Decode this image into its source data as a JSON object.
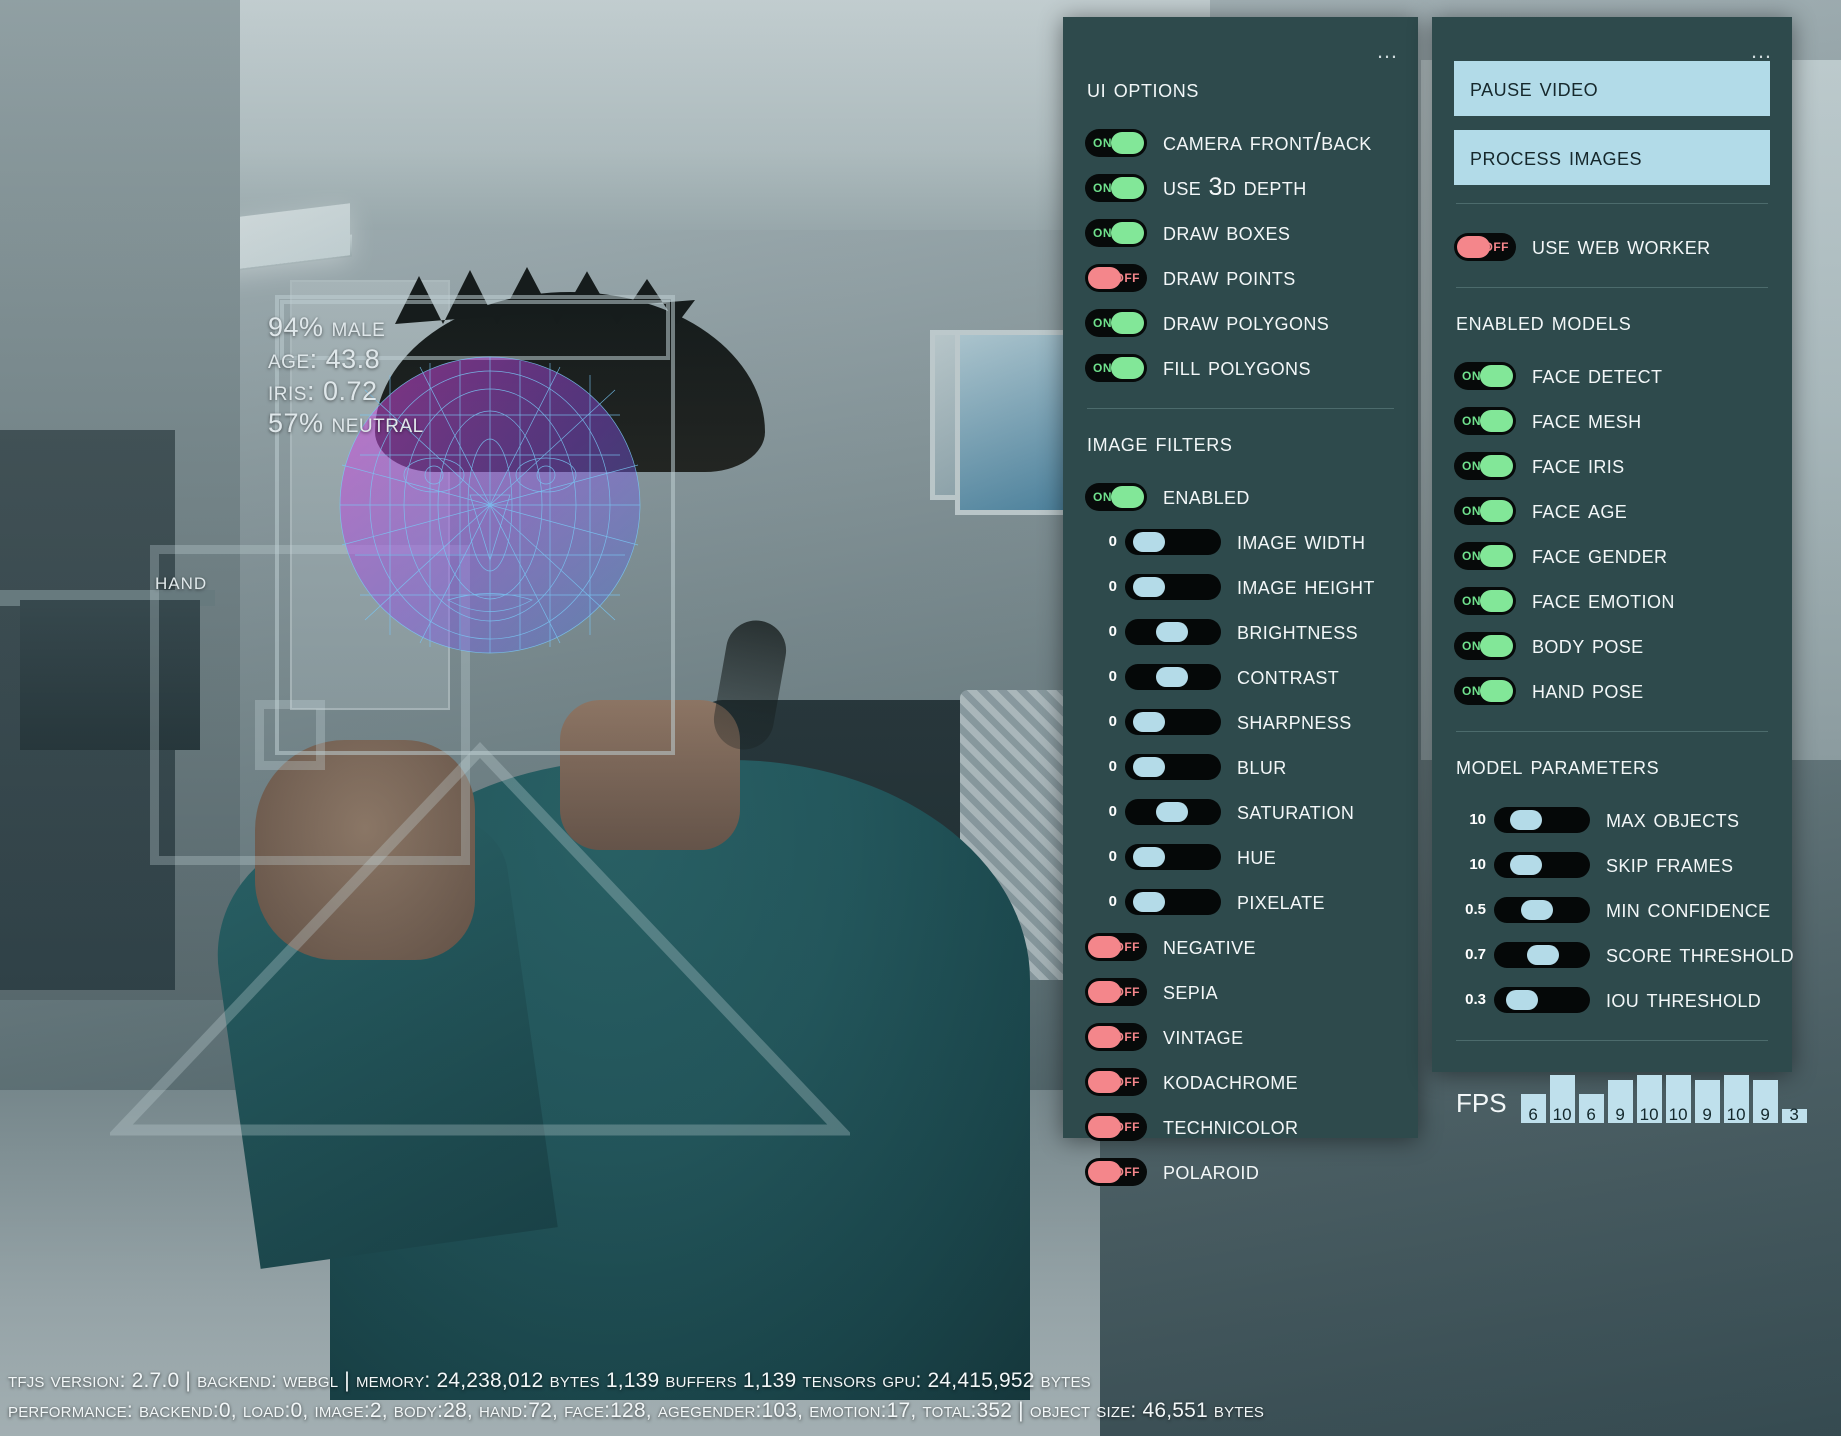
{
  "video": {
    "face_labels": [
      "94% male",
      "Age: 43.8",
      "Iris: 0.72",
      "57% neutral"
    ],
    "hand_label": "Hand"
  },
  "left_panel": {
    "menu_icon": "ellipsis-icon",
    "ui_options": {
      "title": "UI Options",
      "items": [
        {
          "label": "Camera Front/Back",
          "state": "on",
          "state_text": "ON"
        },
        {
          "label": "Use 3D Depth",
          "state": "on",
          "state_text": "ON"
        },
        {
          "label": "Draw Boxes",
          "state": "on",
          "state_text": "ON"
        },
        {
          "label": "Draw Points",
          "state": "off",
          "state_text": "OFF"
        },
        {
          "label": "Draw Polygons",
          "state": "on",
          "state_text": "ON"
        },
        {
          "label": "Fill Polygons",
          "state": "on",
          "state_text": "ON"
        }
      ]
    },
    "image_filters": {
      "title": "Image Filters",
      "enabled": {
        "label": "Enabled",
        "state": "on",
        "state_text": "ON"
      },
      "sliders": [
        {
          "label": "Image width",
          "value": "0",
          "pct": 8
        },
        {
          "label": "Image height",
          "value": "0",
          "pct": 8
        },
        {
          "label": "Brightness",
          "value": "0",
          "pct": 48
        },
        {
          "label": "Contrast",
          "value": "0",
          "pct": 48
        },
        {
          "label": "Sharpness",
          "value": "0",
          "pct": 8
        },
        {
          "label": "Blur",
          "value": "0",
          "pct": 8
        },
        {
          "label": "Saturation",
          "value": "0",
          "pct": 48
        },
        {
          "label": "Hue",
          "value": "0",
          "pct": 8
        },
        {
          "label": "Pixelate",
          "value": "0",
          "pct": 8
        }
      ],
      "toggles": [
        {
          "label": "Negative",
          "state": "off",
          "state_text": "OFF"
        },
        {
          "label": "Sepia",
          "state": "off",
          "state_text": "OFF"
        },
        {
          "label": "Vintage",
          "state": "off",
          "state_text": "OFF"
        },
        {
          "label": "Kodachrome",
          "state": "off",
          "state_text": "OFF"
        },
        {
          "label": "Technicolor",
          "state": "off",
          "state_text": "OFF"
        },
        {
          "label": "Polaroid",
          "state": "off",
          "state_text": "OFF"
        }
      ]
    }
  },
  "right_panel": {
    "menu_icon": "ellipsis-icon",
    "buttons": [
      {
        "label": "Pause Video"
      },
      {
        "label": "Process Images"
      }
    ],
    "web_worker": {
      "label": "Use Web Worker",
      "state": "off",
      "state_text": "OFF"
    },
    "enabled_models": {
      "title": "Enabled Models",
      "items": [
        {
          "label": "Face Detect",
          "state": "on",
          "state_text": "ON"
        },
        {
          "label": "Face Mesh",
          "state": "on",
          "state_text": "ON"
        },
        {
          "label": "Face Iris",
          "state": "on",
          "state_text": "ON"
        },
        {
          "label": "Face Age",
          "state": "on",
          "state_text": "ON"
        },
        {
          "label": "Face Gender",
          "state": "on",
          "state_text": "ON"
        },
        {
          "label": "Face Emotion",
          "state": "on",
          "state_text": "ON"
        },
        {
          "label": "Body Pose",
          "state": "on",
          "state_text": "ON"
        },
        {
          "label": "Hand Pose",
          "state": "on",
          "state_text": "ON"
        }
      ]
    },
    "model_parameters": {
      "title": "Model Parameters",
      "sliders": [
        {
          "label": "Max Objects",
          "value": "10",
          "pct": 22
        },
        {
          "label": "Skip Frames",
          "value": "10",
          "pct": 22
        },
        {
          "label": "Min Confidence",
          "value": "0.5",
          "pct": 42
        },
        {
          "label": "Score Threshold",
          "value": "0.7",
          "pct": 52
        },
        {
          "label": "IOU Threshold",
          "value": "0.3",
          "pct": 16
        }
      ]
    },
    "fps": {
      "label": "FPS",
      "values": [
        6,
        10,
        6,
        9,
        10,
        10,
        9,
        10,
        9,
        3
      ],
      "max": 12
    }
  },
  "status_bar": {
    "line1": "TFJS Version: 2.7.0 | Backend: webgl | Memory: 24,238,012 bytes 1,139 buffers 1,139 tensors GPU: 24,415,952 bytes",
    "line2": "Performance: backend:0, load:0, image:2, body:28, hand:72, face:128, agegender:103, emotion:17, total:352 | Object size: 46,551 bytes"
  },
  "colors": {
    "panel_bg": "#2e4a4c",
    "accent_blue": "#b2dbe8",
    "toggle_on": "#82e798",
    "toggle_off": "#f4868b"
  }
}
